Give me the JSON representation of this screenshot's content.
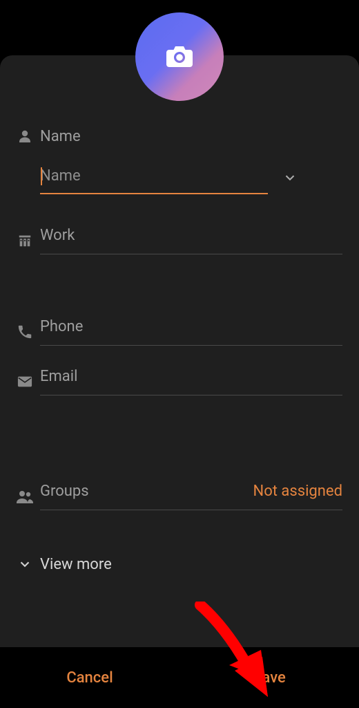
{
  "sections": {
    "name": {
      "label": "Name",
      "placeholder": "Name"
    },
    "work": {
      "label": "Work"
    },
    "phone": {
      "label": "Phone"
    },
    "email": {
      "label": "Email"
    },
    "groups": {
      "label": "Groups",
      "value": "Not assigned"
    },
    "viewMore": {
      "label": "View more"
    }
  },
  "buttons": {
    "cancel": "Cancel",
    "save": "Save"
  },
  "colors": {
    "accent": "#e5843f"
  }
}
